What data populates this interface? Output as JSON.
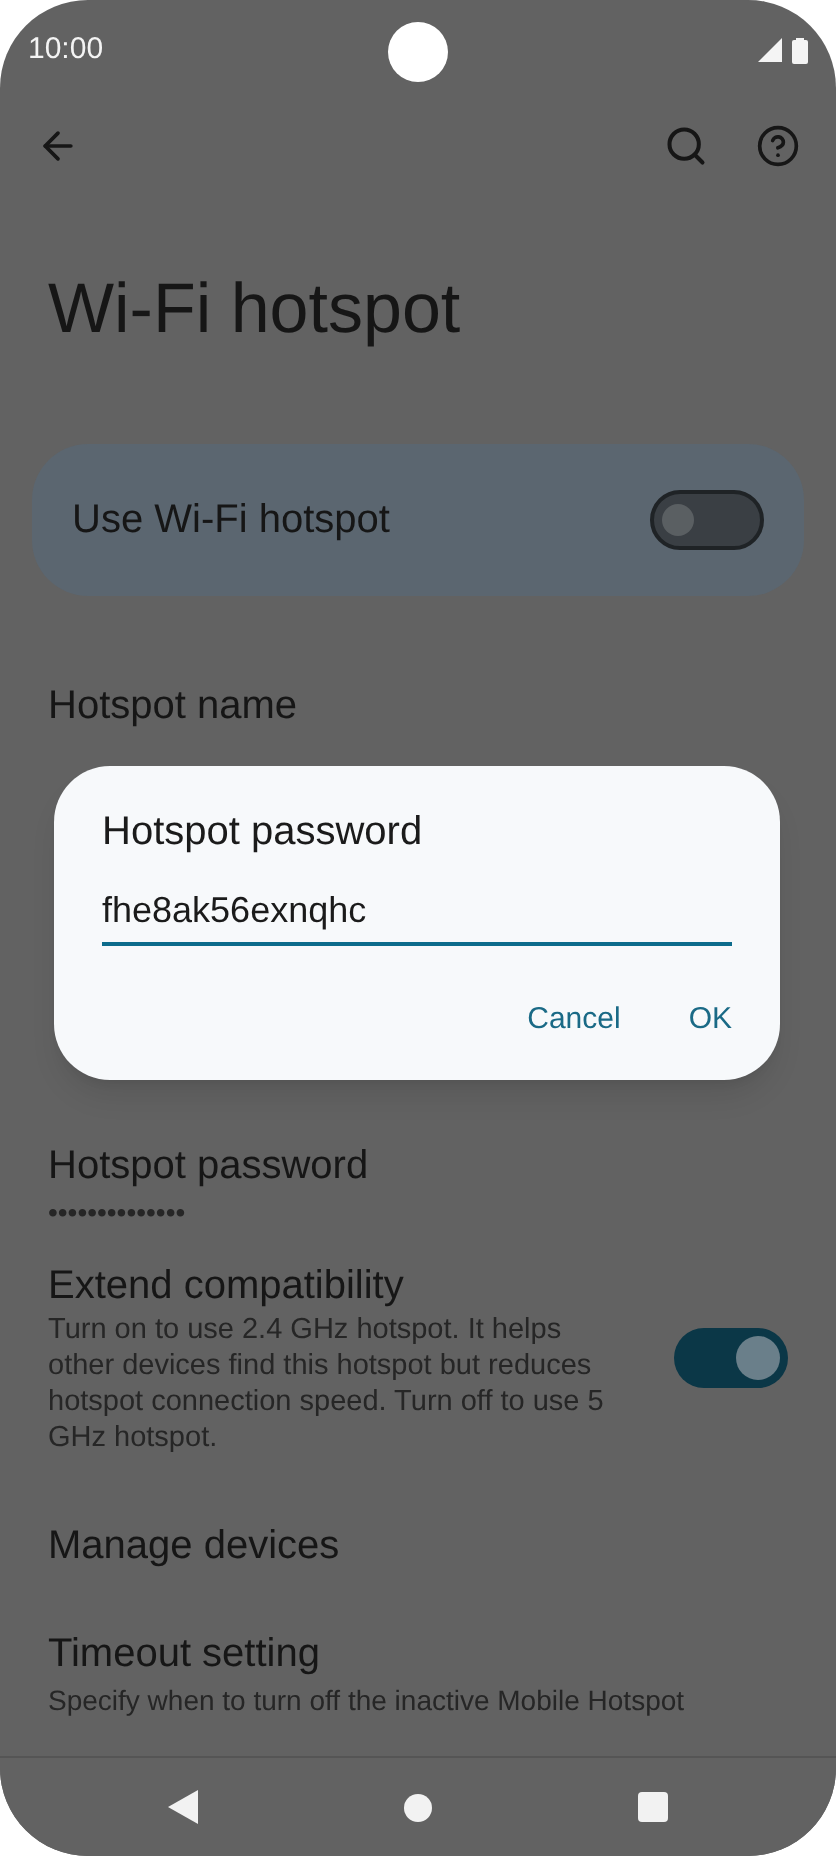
{
  "status_bar": {
    "time": "10:00"
  },
  "title": "Wi-Fi hotspot",
  "main_switch": {
    "label": "Use Wi-Fi hotspot",
    "on": false
  },
  "settings": [
    {
      "kind": "text",
      "title": "Hotspot name"
    },
    {
      "kind": "hidden"
    },
    {
      "kind": "hidden"
    },
    {
      "kind": "text",
      "title": "Hotspot password",
      "subtitle": "••••••••••••••"
    },
    {
      "kind": "switch",
      "title": "Extend compatibility",
      "subtitle": "Turn on to use 2.4 GHz hotspot. It helps other devices find this hotspot but reduces hotspot connection speed. Turn off to use 5 GHz hotspot.",
      "on": true
    },
    {
      "kind": "text",
      "title": "Manage devices"
    },
    {
      "kind": "text",
      "title": "Timeout setting",
      "subtitle": "Specify when to turn off the inactive Mobile Hotspot"
    }
  ],
  "dialog": {
    "title": "Hotspot password",
    "value": "fhe8ak56exnqhc",
    "buttons": [
      "Cancel",
      "OK"
    ]
  }
}
